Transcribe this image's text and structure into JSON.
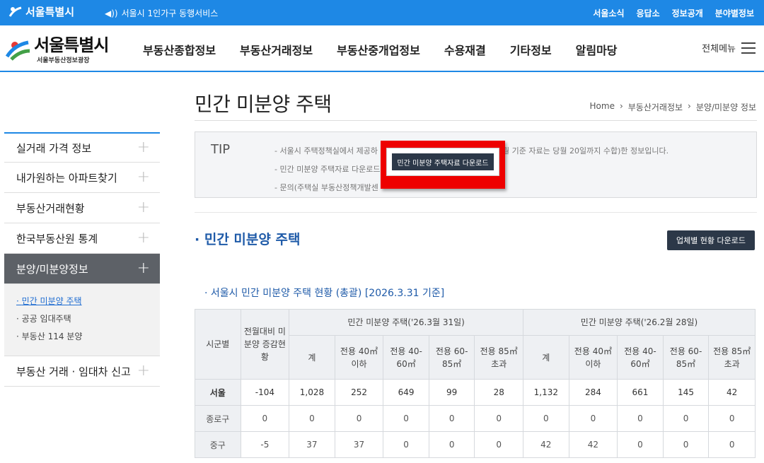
{
  "topbar": {
    "logo_text": "서울특별시",
    "notice": "서울시 1인가구 동행서비스",
    "links": [
      "서울소식",
      "응답소",
      "정보공개",
      "분야별정보"
    ]
  },
  "header": {
    "brand_title": "서울특별시",
    "brand_sub": "서울부동산정보광장",
    "nav": [
      "부동산종합정보",
      "부동산거래정보",
      "부동산중개업정보",
      "수용재결",
      "기타정보",
      "알림마당"
    ],
    "all_menu": "전체메뉴"
  },
  "sidebar": {
    "items": [
      "실거래 가격 정보",
      "내가원하는 아파트찾기",
      "부동산거래현황",
      "한국부동산원 통계",
      "분양/미분양정보"
    ],
    "sub_items": [
      "민간 미분양 주택",
      "공공 임대주택",
      "부동산 114 분양"
    ],
    "last_item": "부동산 거래 · 임대차 신고",
    "plus": "+"
  },
  "content": {
    "page_title": "민간 미분양 주택",
    "breadcrumb": [
      "Home",
      "부동산거래정보",
      "분양/미분양 정보"
    ],
    "tip": {
      "label": "TIP",
      "line1_a": "- 서울시 주택정책실에서 제공하",
      "line1_b": "월 기준 자료는 당월 20일까지 수합)한 정보입니다.",
      "line2": "- 민간 미분양 주택자료 다운로드",
      "line3": "- 문의(주택실 부동산정책개발센",
      "download_btn": "민간 미분양 주택자료 다운로드"
    },
    "section_title": "· 민간 미분양 주택",
    "biz_download": "업체별 현황 다운로드",
    "sub_title": "· 서울시 민간 미분양 주택 현황 (총괄) [2026.3.31 기준]"
  },
  "table": {
    "h_region": "시군별",
    "h_change": "전월대비 미분양 증감현황",
    "h_group1": "민간 미분양 주택('26.3월 31일)",
    "h_group2": "민간 미분양 주택('26.2월 28일)",
    "sub_headers": [
      "계",
      "전용 40㎡이하",
      "전용 40-60㎡",
      "전용 60-85㎡",
      "전용 85㎡초과"
    ],
    "rows": [
      {
        "region": "서울",
        "cells": [
          "-104",
          "1,028",
          "252",
          "649",
          "99",
          "28",
          "1,132",
          "284",
          "661",
          "145",
          "42"
        ]
      },
      {
        "region": "종로구",
        "cells": [
          "0",
          "0",
          "0",
          "0",
          "0",
          "0",
          "0",
          "0",
          "0",
          "0",
          "0"
        ]
      },
      {
        "region": "중구",
        "cells": [
          "-5",
          "37",
          "37",
          "0",
          "0",
          "0",
          "42",
          "42",
          "0",
          "0",
          "0"
        ]
      }
    ]
  },
  "colors": {
    "primary": "#1e88e5",
    "dark_button": "#2c3848",
    "highlight": "#ee0000",
    "link_blue": "#1e5aa8"
  }
}
